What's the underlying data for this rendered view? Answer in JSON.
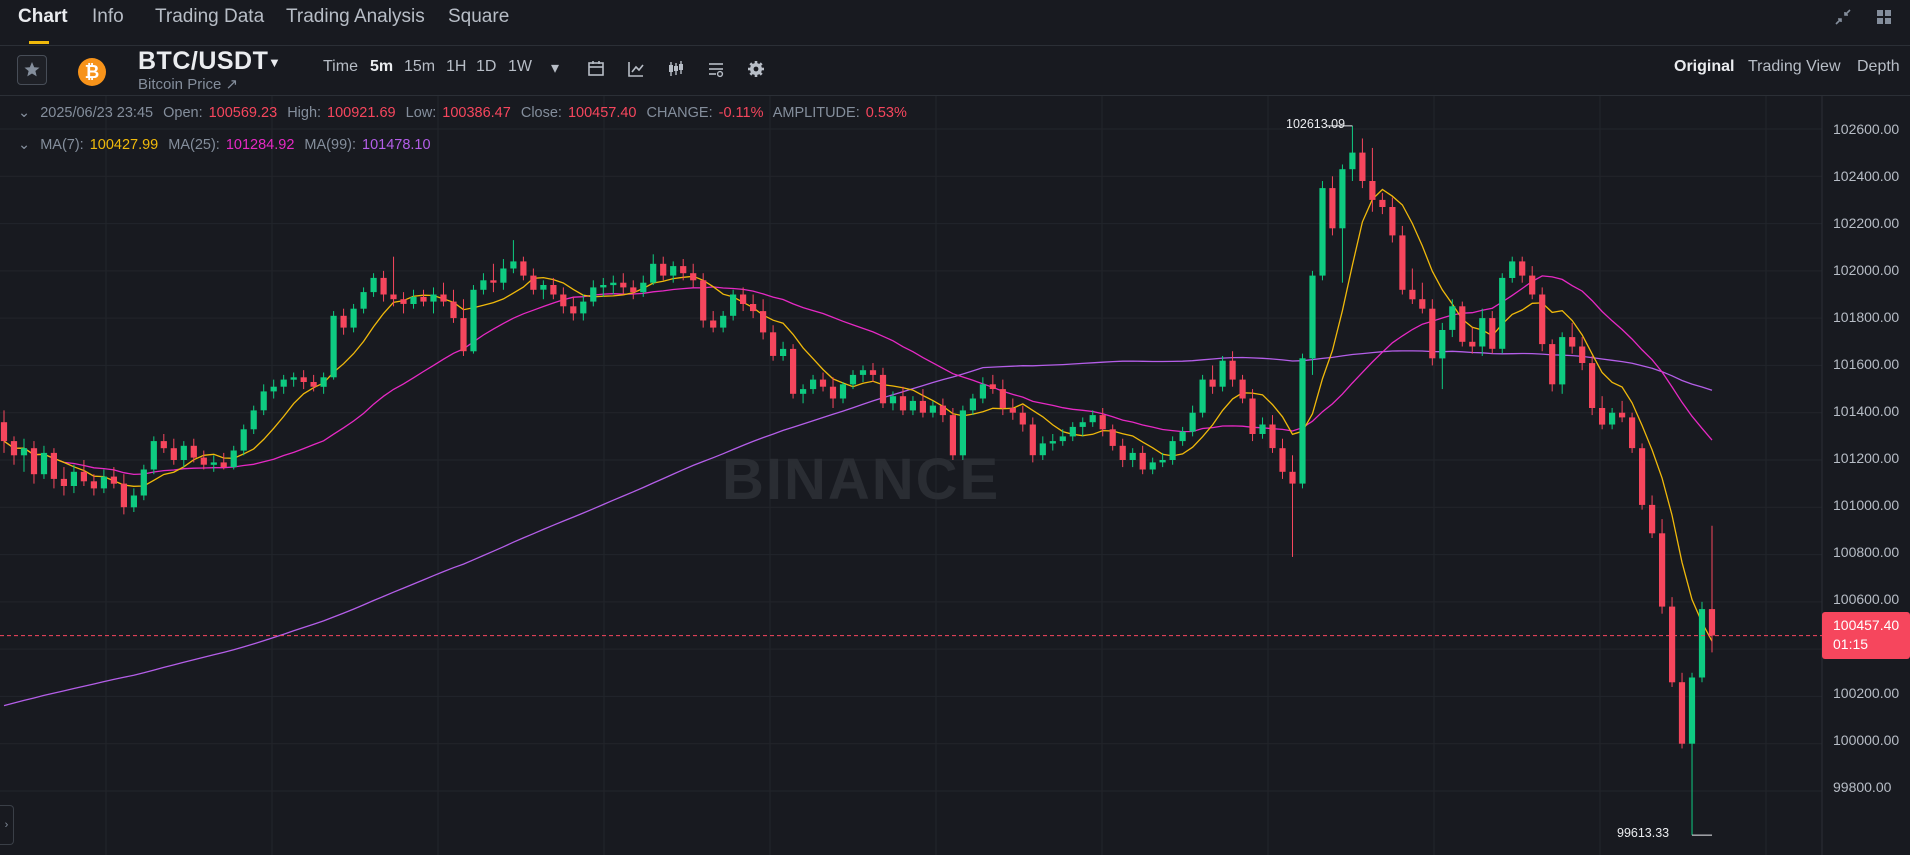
{
  "nav": {
    "tabs": [
      {
        "label": "Chart",
        "active": true
      },
      {
        "label": "Info"
      },
      {
        "label": "Trading Data"
      },
      {
        "label": "Trading Analysis"
      },
      {
        "label": "Square"
      }
    ]
  },
  "symbol": {
    "pair": "BTC/USDT",
    "subtitle": "Bitcoin Price ↗",
    "coin_color": "#f7931a",
    "coin_glyph": "₿"
  },
  "timeframes": [
    {
      "label": "Time"
    },
    {
      "label": "5m",
      "active": true
    },
    {
      "label": "15m"
    },
    {
      "label": "1H"
    },
    {
      "label": "1D"
    },
    {
      "label": "1W"
    },
    {
      "label": "▾"
    }
  ],
  "views": [
    {
      "label": "Original",
      "active": true
    },
    {
      "label": "Trading View"
    },
    {
      "label": "Depth"
    }
  ],
  "ohlc": {
    "date": "2025/06/23 23:45",
    "open_label": "Open:",
    "open": "100569.23",
    "high_label": "High:",
    "high": "100921.69",
    "low_label": "Low:",
    "low": "100386.47",
    "close_label": "Close:",
    "close": "100457.40",
    "change_label": "CHANGE:",
    "change": "-0.11%",
    "amplitude_label": "AMPLITUDE:",
    "amplitude": "0.53%"
  },
  "ma": {
    "ma7_label": "MA(7):",
    "ma7": "100427.99",
    "ma25_label": "MA(25):",
    "ma25": "101284.92",
    "ma99_label": "MA(99):",
    "ma99": "101478.10"
  },
  "y_axis_ticks": [
    "102600.00",
    "102400.00",
    "102200.00",
    "102000.00",
    "101800.00",
    "101600.00",
    "101400.00",
    "101200.00",
    "101000.00",
    "100800.00",
    "100600.00",
    "100200.00",
    "100000.00",
    "99800.00"
  ],
  "last_price": {
    "price": "100457.40",
    "countdown": "01:15"
  },
  "extremes": {
    "high": "102613.09",
    "low": "99613.33"
  },
  "watermark": "BINANCE",
  "colors": {
    "up": "#0ecb81",
    "down": "#f6465d",
    "ma7": "#f0b90b",
    "ma25": "#e629c4",
    "ma99": "#b45ee8"
  },
  "chart_data": {
    "type": "candlestick",
    "interval": "5m",
    "ylim": [
      99613.33,
      102613.09
    ],
    "last": 100457.4,
    "candles": [
      [
        101360,
        101410,
        101230,
        101280
      ],
      [
        101280,
        101300,
        101180,
        101220
      ],
      [
        101220,
        101290,
        101150,
        101250
      ],
      [
        101250,
        101280,
        101100,
        101140
      ],
      [
        101140,
        101260,
        101120,
        101230
      ],
      [
        101230,
        101250,
        101080,
        101120
      ],
      [
        101120,
        101170,
        101050,
        101090
      ],
      [
        101090,
        101180,
        101060,
        101150
      ],
      [
        101150,
        101200,
        101090,
        101110
      ],
      [
        101110,
        101140,
        101050,
        101080
      ],
      [
        101080,
        101160,
        101060,
        101130
      ],
      [
        101130,
        101170,
        101080,
        101100
      ],
      [
        101100,
        101140,
        100970,
        101000
      ],
      [
        101000,
        101080,
        100980,
        101050
      ],
      [
        101050,
        101180,
        101030,
        101160
      ],
      [
        101160,
        101300,
        101140,
        101280
      ],
      [
        101280,
        101310,
        101230,
        101250
      ],
      [
        101250,
        101290,
        101180,
        101200
      ],
      [
        101200,
        101280,
        101170,
        101260
      ],
      [
        101260,
        101290,
        101190,
        101210
      ],
      [
        101210,
        101240,
        101160,
        101180
      ],
      [
        101180,
        101220,
        101150,
        101190
      ],
      [
        101190,
        101230,
        101160,
        101170
      ],
      [
        101170,
        101260,
        101160,
        101240
      ],
      [
        101240,
        101350,
        101220,
        101330
      ],
      [
        101330,
        101430,
        101310,
        101410
      ],
      [
        101410,
        101520,
        101390,
        101490
      ],
      [
        101490,
        101540,
        101460,
        101510
      ],
      [
        101510,
        101560,
        101480,
        101540
      ],
      [
        101540,
        101570,
        101510,
        101550
      ],
      [
        101550,
        101580,
        101500,
        101530
      ],
      [
        101530,
        101560,
        101490,
        101510
      ],
      [
        101510,
        101570,
        101480,
        101550
      ],
      [
        101550,
        101830,
        101540,
        101810
      ],
      [
        101810,
        101840,
        101730,
        101760
      ],
      [
        101760,
        101860,
        101740,
        101840
      ],
      [
        101840,
        101930,
        101820,
        101910
      ],
      [
        101910,
        101990,
        101890,
        101970
      ],
      [
        101970,
        102000,
        101870,
        101900
      ],
      [
        101900,
        102060,
        101850,
        101880
      ],
      [
        101880,
        101910,
        101820,
        101860
      ],
      [
        101860,
        101920,
        101840,
        101890
      ],
      [
        101890,
        101920,
        101850,
        101870
      ],
      [
        101870,
        101930,
        101820,
        101900
      ],
      [
        101900,
        101950,
        101850,
        101870
      ],
      [
        101870,
        101920,
        101780,
        101800
      ],
      [
        101800,
        101880,
        101640,
        101660
      ],
      [
        101660,
        101940,
        101650,
        101920
      ],
      [
        101920,
        101990,
        101900,
        101960
      ],
      [
        101960,
        102030,
        101910,
        101950
      ],
      [
        101950,
        102050,
        101920,
        102010
      ],
      [
        102010,
        102130,
        101990,
        102040
      ],
      [
        102040,
        102060,
        101960,
        101980
      ],
      [
        101980,
        102010,
        101900,
        101920
      ],
      [
        101920,
        101960,
        101880,
        101940
      ],
      [
        101940,
        101970,
        101880,
        101900
      ],
      [
        101900,
        101930,
        101820,
        101850
      ],
      [
        101850,
        101890,
        101790,
        101820
      ],
      [
        101820,
        101900,
        101790,
        101870
      ],
      [
        101870,
        101960,
        101850,
        101930
      ],
      [
        101930,
        101970,
        101890,
        101940
      ],
      [
        101940,
        101980,
        101900,
        101950
      ],
      [
        101950,
        101990,
        101900,
        101930
      ],
      [
        101930,
        101960,
        101880,
        101910
      ],
      [
        101910,
        101980,
        101890,
        101950
      ],
      [
        101950,
        102070,
        101940,
        102030
      ],
      [
        102030,
        102060,
        101960,
        101980
      ],
      [
        101980,
        102040,
        101950,
        102020
      ],
      [
        102020,
        102050,
        101960,
        101990
      ],
      [
        101990,
        102030,
        101930,
        101960
      ],
      [
        101960,
        101990,
        101760,
        101790
      ],
      [
        101790,
        101830,
        101740,
        101760
      ],
      [
        101760,
        101830,
        101740,
        101810
      ],
      [
        101810,
        101920,
        101790,
        101900
      ],
      [
        101900,
        101930,
        101830,
        101860
      ],
      [
        101860,
        101900,
        101800,
        101830
      ],
      [
        101830,
        101880,
        101710,
        101740
      ],
      [
        101740,
        101770,
        101620,
        101640
      ],
      [
        101640,
        101700,
        101620,
        101670
      ],
      [
        101670,
        101690,
        101460,
        101480
      ],
      [
        101480,
        101520,
        101440,
        101500
      ],
      [
        101500,
        101560,
        101480,
        101540
      ],
      [
        101540,
        101570,
        101490,
        101510
      ],
      [
        101510,
        101550,
        101420,
        101460
      ],
      [
        101460,
        101530,
        101440,
        101520
      ],
      [
        101520,
        101580,
        101500,
        101560
      ],
      [
        101560,
        101600,
        101530,
        101580
      ],
      [
        101580,
        101610,
        101530,
        101560
      ],
      [
        101560,
        101590,
        101420,
        101440
      ],
      [
        101440,
        101490,
        101410,
        101470
      ],
      [
        101470,
        101510,
        101390,
        101410
      ],
      [
        101410,
        101470,
        101390,
        101450
      ],
      [
        101450,
        101500,
        101380,
        101400
      ],
      [
        101400,
        101450,
        101380,
        101430
      ],
      [
        101430,
        101460,
        101360,
        101390
      ],
      [
        101390,
        101420,
        101200,
        101220
      ],
      [
        101220,
        101430,
        101200,
        101410
      ],
      [
        101410,
        101480,
        101390,
        101460
      ],
      [
        101460,
        101550,
        101440,
        101520
      ],
      [
        101520,
        101560,
        101480,
        101500
      ],
      [
        101500,
        101540,
        101390,
        101420
      ],
      [
        101420,
        101460,
        101370,
        101400
      ],
      [
        101400,
        101430,
        101320,
        101350
      ],
      [
        101350,
        101380,
        101190,
        101220
      ],
      [
        101220,
        101300,
        101200,
        101270
      ],
      [
        101270,
        101310,
        101240,
        101280
      ],
      [
        101280,
        101330,
        101260,
        101300
      ],
      [
        101300,
        101360,
        101280,
        101340
      ],
      [
        101340,
        101380,
        101300,
        101360
      ],
      [
        101360,
        101410,
        101340,
        101390
      ],
      [
        101390,
        101420,
        101300,
        101330
      ],
      [
        101330,
        101350,
        101240,
        101260
      ],
      [
        101260,
        101290,
        101170,
        101200
      ],
      [
        101200,
        101250,
        101170,
        101230
      ],
      [
        101230,
        101260,
        101140,
        101160
      ],
      [
        101160,
        101210,
        101140,
        101190
      ],
      [
        101190,
        101230,
        101170,
        101200
      ],
      [
        101200,
        101300,
        101180,
        101280
      ],
      [
        101280,
        101340,
        101260,
        101320
      ],
      [
        101320,
        101430,
        101300,
        101400
      ],
      [
        101400,
        101560,
        101380,
        101540
      ],
      [
        101540,
        101600,
        101480,
        101510
      ],
      [
        101510,
        101640,
        101490,
        101620
      ],
      [
        101620,
        101660,
        101510,
        101540
      ],
      [
        101540,
        101560,
        101440,
        101460
      ],
      [
        101460,
        101500,
        101280,
        101310
      ],
      [
        101310,
        101380,
        101290,
        101350
      ],
      [
        101350,
        101390,
        101230,
        101250
      ],
      [
        101250,
        101290,
        101120,
        101150
      ],
      [
        101150,
        101220,
        100790,
        101100
      ],
      [
        101100,
        101650,
        101080,
        101630
      ],
      [
        101630,
        102000,
        101560,
        101980
      ],
      [
        101980,
        102380,
        101960,
        102350
      ],
      [
        102350,
        102400,
        102150,
        102180
      ],
      [
        102180,
        102450,
        101950,
        102430
      ],
      [
        102430,
        102613.09,
        102380,
        102500
      ],
      [
        102500,
        102560,
        102350,
        102380
      ],
      [
        102380,
        102520,
        102250,
        102300
      ],
      [
        102300,
        102330,
        102240,
        102270
      ],
      [
        102270,
        102310,
        102120,
        102150
      ],
      [
        102150,
        102190,
        101900,
        101920
      ],
      [
        101920,
        102010,
        101860,
        101880
      ],
      [
        101880,
        101950,
        101820,
        101840
      ],
      [
        101840,
        101880,
        101600,
        101630
      ],
      [
        101630,
        101780,
        101500,
        101750
      ],
      [
        101750,
        101880,
        101720,
        101850
      ],
      [
        101850,
        101870,
        101680,
        101700
      ],
      [
        101700,
        101760,
        101650,
        101680
      ],
      [
        101680,
        101840,
        101640,
        101800
      ],
      [
        101800,
        101830,
        101650,
        101670
      ],
      [
        101670,
        101990,
        101650,
        101970
      ],
      [
        101970,
        102060,
        101950,
        102040
      ],
      [
        102040,
        102060,
        101950,
        101980
      ],
      [
        101980,
        102020,
        101880,
        101900
      ],
      [
        101900,
        101930,
        101660,
        101690
      ],
      [
        101690,
        101710,
        101490,
        101520
      ],
      [
        101520,
        101740,
        101480,
        101720
      ],
      [
        101720,
        101780,
        101650,
        101680
      ],
      [
        101680,
        101720,
        101580,
        101610
      ],
      [
        101610,
        101640,
        101390,
        101420
      ],
      [
        101420,
        101470,
        101330,
        101350
      ],
      [
        101350,
        101420,
        101330,
        101400
      ],
      [
        101400,
        101450,
        101360,
        101380
      ],
      [
        101380,
        101400,
        101230,
        101250
      ],
      [
        101250,
        101270,
        100990,
        101010
      ],
      [
        101010,
        101050,
        100870,
        100890
      ],
      [
        100890,
        100950,
        100550,
        100580
      ],
      [
        100580,
        100620,
        100240,
        100260
      ],
      [
        100260,
        100300,
        99980,
        100000
      ],
      [
        100000,
        100300,
        99613.33,
        100280
      ],
      [
        100280,
        100600,
        100260,
        100569.23
      ],
      [
        100569.23,
        100921.69,
        100386.47,
        100457.4
      ]
    ]
  }
}
